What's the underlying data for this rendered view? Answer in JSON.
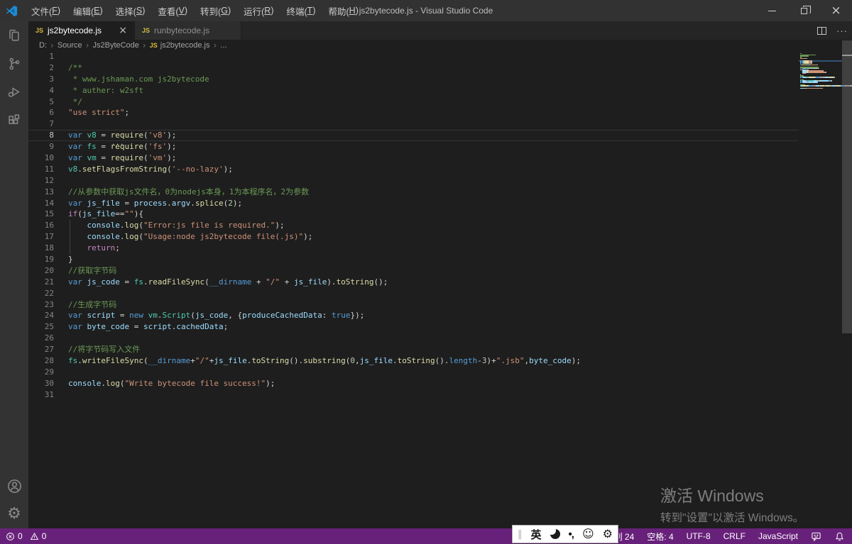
{
  "window": {
    "title": "js2bytecode.js - Visual Studio Code",
    "controls": [
      {
        "name": "minimize-button"
      },
      {
        "name": "restore-button"
      },
      {
        "name": "close-button"
      }
    ]
  },
  "menu": {
    "items": [
      {
        "name": "menu-file",
        "pre": "文件(",
        "key": "F",
        "post": ")"
      },
      {
        "name": "menu-edit",
        "pre": "编辑(",
        "key": "E",
        "post": ")"
      },
      {
        "name": "menu-selection",
        "pre": "选择(",
        "key": "S",
        "post": ")"
      },
      {
        "name": "menu-view",
        "pre": "查看(",
        "key": "V",
        "post": ")"
      },
      {
        "name": "menu-go",
        "pre": "转到(",
        "key": "G",
        "post": ")"
      },
      {
        "name": "menu-run",
        "pre": "运行(",
        "key": "R",
        "post": ")"
      },
      {
        "name": "menu-terminal",
        "pre": "终端(",
        "key": "T",
        "post": ")"
      },
      {
        "name": "menu-help",
        "pre": "帮助(",
        "key": "H",
        "post": ")"
      }
    ]
  },
  "activity_bar": {
    "items": [
      {
        "name": "explorer-icon"
      },
      {
        "name": "source-control-icon"
      },
      {
        "name": "run-debug-icon"
      },
      {
        "name": "extensions-icon"
      }
    ],
    "bottom": [
      {
        "name": "account-icon"
      },
      {
        "name": "settings-gear-icon",
        "glyph": "⚙"
      }
    ]
  },
  "tabs": [
    {
      "name": "tab-js2bytecode",
      "label": "js2bytecode.js",
      "badge": "JS",
      "active": true,
      "close_glyph": "×"
    },
    {
      "name": "tab-runbytecode",
      "label": "runbytecode.js",
      "badge": "JS",
      "active": false,
      "close_glyph": ""
    }
  ],
  "editor_actions": {
    "split_label": "split-editor",
    "more_glyph": "···"
  },
  "breadcrumb": [
    {
      "label": "D:"
    },
    {
      "label": "Source"
    },
    {
      "label": "Js2ByteCode"
    },
    {
      "label": "js2bytecode.js",
      "badge": "JS"
    },
    {
      "label": "..."
    }
  ],
  "code": {
    "cursor_line": 8,
    "cursor_col": 24,
    "lines": [
      {
        "n": 1,
        "tk": []
      },
      {
        "n": 2,
        "tk": [
          [
            "cm",
            "/**"
          ]
        ]
      },
      {
        "n": 3,
        "tk": [
          [
            "cm",
            " * www.jshaman.com js2bytecode"
          ]
        ]
      },
      {
        "n": 4,
        "tk": [
          [
            "cm",
            " * auther: w2sft"
          ]
        ]
      },
      {
        "n": 5,
        "tk": [
          [
            "cm",
            " */"
          ]
        ]
      },
      {
        "n": 6,
        "tk": [
          [
            "st",
            "\"use strict\""
          ],
          [
            "pn",
            ";"
          ]
        ]
      },
      {
        "n": 7,
        "tk": []
      },
      {
        "n": 8,
        "cur": true,
        "tk": [
          [
            "kw",
            "var"
          ],
          [
            "pn",
            " "
          ],
          [
            "cls",
            "v8"
          ],
          [
            "pn",
            " = "
          ],
          [
            "fn hint",
            "require"
          ],
          [
            "pn",
            "("
          ],
          [
            "st",
            "'v8'"
          ],
          [
            "pn",
            ");"
          ]
        ]
      },
      {
        "n": 9,
        "tk": [
          [
            "kw",
            "var"
          ],
          [
            "pn",
            " "
          ],
          [
            "cls",
            "fs"
          ],
          [
            "pn",
            " = "
          ],
          [
            "fn",
            "require"
          ],
          [
            "pn",
            "("
          ],
          [
            "st",
            "'fs'"
          ],
          [
            "pn",
            ");"
          ]
        ]
      },
      {
        "n": 10,
        "tk": [
          [
            "kw",
            "var"
          ],
          [
            "pn",
            " "
          ],
          [
            "cls",
            "vm"
          ],
          [
            "pn",
            " = "
          ],
          [
            "fn",
            "require"
          ],
          [
            "pn",
            "("
          ],
          [
            "st",
            "'vm'"
          ],
          [
            "pn",
            ");"
          ]
        ]
      },
      {
        "n": 11,
        "tk": [
          [
            "cls",
            "v8"
          ],
          [
            "pn",
            "."
          ],
          [
            "fn",
            "setFlagsFromString"
          ],
          [
            "pn",
            "("
          ],
          [
            "st",
            "'--no-lazy'"
          ],
          [
            "pn",
            ");"
          ]
        ]
      },
      {
        "n": 12,
        "tk": []
      },
      {
        "n": 13,
        "tk": [
          [
            "cm",
            "//从参数中获取js文件名，0为nodejs本身，1为本程序名，2为参数"
          ]
        ]
      },
      {
        "n": 14,
        "tk": [
          [
            "kw",
            "var"
          ],
          [
            "pn",
            " "
          ],
          [
            "vr",
            "js_file"
          ],
          [
            "pn",
            " = "
          ],
          [
            "vr",
            "process"
          ],
          [
            "pn",
            "."
          ],
          [
            "vr",
            "argv"
          ],
          [
            "pn",
            "."
          ],
          [
            "fn",
            "splice"
          ],
          [
            "pn",
            "("
          ],
          [
            "nm",
            "2"
          ],
          [
            "pn",
            ");"
          ]
        ]
      },
      {
        "n": 15,
        "tk": [
          [
            "ct",
            "if"
          ],
          [
            "pn",
            "("
          ],
          [
            "vr",
            "js_file"
          ],
          [
            "pn",
            "=="
          ],
          [
            "st",
            "\"\""
          ],
          [
            "pn",
            "){"
          ]
        ]
      },
      {
        "n": 16,
        "g": true,
        "tk": [
          [
            "pn",
            "    "
          ],
          [
            "vr",
            "console"
          ],
          [
            "pn",
            "."
          ],
          [
            "fn",
            "log"
          ],
          [
            "pn",
            "("
          ],
          [
            "st",
            "\"Error:js file is required.\""
          ],
          [
            "pn",
            ");"
          ]
        ]
      },
      {
        "n": 17,
        "g": true,
        "tk": [
          [
            "pn",
            "    "
          ],
          [
            "vr",
            "console"
          ],
          [
            "pn",
            "."
          ],
          [
            "fn",
            "log"
          ],
          [
            "pn",
            "("
          ],
          [
            "st",
            "\"Usage:node js2bytecode file(.js)\""
          ],
          [
            "pn",
            ");"
          ]
        ]
      },
      {
        "n": 18,
        "g": true,
        "tk": [
          [
            "pn",
            "    "
          ],
          [
            "ct",
            "return"
          ],
          [
            "pn",
            ";"
          ]
        ]
      },
      {
        "n": 19,
        "tk": [
          [
            "pn",
            "}"
          ]
        ]
      },
      {
        "n": 20,
        "tk": [
          [
            "cm",
            "//获取字节码"
          ]
        ]
      },
      {
        "n": 21,
        "tk": [
          [
            "kw",
            "var"
          ],
          [
            "pn",
            " "
          ],
          [
            "vr",
            "js_code"
          ],
          [
            "pn",
            " = "
          ],
          [
            "cls",
            "fs"
          ],
          [
            "pn",
            "."
          ],
          [
            "fn",
            "readFileSync"
          ],
          [
            "pn",
            "("
          ],
          [
            "kw",
            "__dirname"
          ],
          [
            "pn",
            " + "
          ],
          [
            "st",
            "\"/\""
          ],
          [
            "pn",
            " + "
          ],
          [
            "vr",
            "js_file"
          ],
          [
            "pn",
            ")."
          ],
          [
            "fn",
            "toString"
          ],
          [
            "pn",
            "();"
          ]
        ]
      },
      {
        "n": 22,
        "tk": []
      },
      {
        "n": 23,
        "tk": [
          [
            "cm",
            "//生成字节码"
          ]
        ]
      },
      {
        "n": 24,
        "tk": [
          [
            "kw",
            "var"
          ],
          [
            "pn",
            " "
          ],
          [
            "vr",
            "script"
          ],
          [
            "pn",
            " = "
          ],
          [
            "kw",
            "new"
          ],
          [
            "pn",
            " "
          ],
          [
            "cls",
            "vm"
          ],
          [
            "pn",
            "."
          ],
          [
            "cls",
            "Script"
          ],
          [
            "pn",
            "("
          ],
          [
            "vr",
            "js_code"
          ],
          [
            "pn",
            ", {"
          ],
          [
            "vr",
            "produceCachedData"
          ],
          [
            "pn",
            ": "
          ],
          [
            "kw",
            "true"
          ],
          [
            "pn",
            "});"
          ]
        ]
      },
      {
        "n": 25,
        "tk": [
          [
            "kw",
            "var"
          ],
          [
            "pn",
            " "
          ],
          [
            "vr",
            "byte_code"
          ],
          [
            "pn",
            " = "
          ],
          [
            "vr",
            "script"
          ],
          [
            "pn",
            "."
          ],
          [
            "vr",
            "cachedData"
          ],
          [
            "pn",
            ";"
          ]
        ]
      },
      {
        "n": 26,
        "tk": []
      },
      {
        "n": 27,
        "tk": [
          [
            "cm",
            "//将字节码写入文件"
          ]
        ]
      },
      {
        "n": 28,
        "tk": [
          [
            "cls",
            "fs"
          ],
          [
            "pn",
            "."
          ],
          [
            "fn",
            "writeFileSync"
          ],
          [
            "pn",
            "("
          ],
          [
            "kw",
            "__dirname"
          ],
          [
            "pn",
            "+"
          ],
          [
            "st",
            "\"/\""
          ],
          [
            "pn",
            "+"
          ],
          [
            "vr",
            "js_file"
          ],
          [
            "pn",
            "."
          ],
          [
            "fn",
            "toString"
          ],
          [
            "pn",
            "()."
          ],
          [
            "fn",
            "substring"
          ],
          [
            "pn",
            "("
          ],
          [
            "nm",
            "0"
          ],
          [
            "pn",
            ","
          ],
          [
            "vr",
            "js_file"
          ],
          [
            "pn",
            "."
          ],
          [
            "fn",
            "toString"
          ],
          [
            "pn",
            "()."
          ],
          [
            "kw",
            "length"
          ],
          [
            "pn",
            "-"
          ],
          [
            "nm",
            "3"
          ],
          [
            "pn",
            ")+"
          ],
          [
            "st",
            "\".jsb\""
          ],
          [
            "pn",
            ","
          ],
          [
            "vr",
            "byte_code"
          ],
          [
            "pn",
            ");"
          ]
        ]
      },
      {
        "n": 29,
        "tk": []
      },
      {
        "n": 30,
        "tk": [
          [
            "vr",
            "console"
          ],
          [
            "pn",
            "."
          ],
          [
            "fn",
            "log"
          ],
          [
            "pn",
            "("
          ],
          [
            "st",
            "\"Write bytecode file success!\""
          ],
          [
            "pn",
            ");"
          ]
        ]
      },
      {
        "n": 31,
        "tk": []
      }
    ]
  },
  "watermark": {
    "line1": "激活 Windows",
    "line2": "转到\"设置\"以激活 Windows。"
  },
  "ime": {
    "handle": "‖",
    "lang": "英",
    "punct": "•,",
    "smiley": "☺",
    "gear": "⚙"
  },
  "status_bar": {
    "errors": "0",
    "warnings": "0",
    "right_items": [
      {
        "name": "cursor-position",
        "label": "行 8, 列 24"
      },
      {
        "name": "indentation",
        "label": "空格: 4"
      },
      {
        "name": "encoding",
        "label": "UTF-8"
      },
      {
        "name": "eol-sequence",
        "label": "CRLF"
      },
      {
        "name": "language-mode",
        "label": "JavaScript"
      }
    ]
  },
  "colors": {
    "status_bar": "#68217A",
    "title_bar": "#323233",
    "activity_bar": "#333333",
    "editor_bg": "#1E1E1E",
    "tab_bar": "#252526",
    "js_badge": "#D7BA3D",
    "syntax": {
      "keyword": "#569CD6",
      "control": "#C586C0",
      "function": "#DCDCAA",
      "class": "#4EC9B0",
      "variable": "#9CDCFE",
      "string": "#CE9178",
      "number": "#B5CEA8",
      "comment": "#6A9955",
      "punctuation": "#D4D4D4"
    }
  }
}
